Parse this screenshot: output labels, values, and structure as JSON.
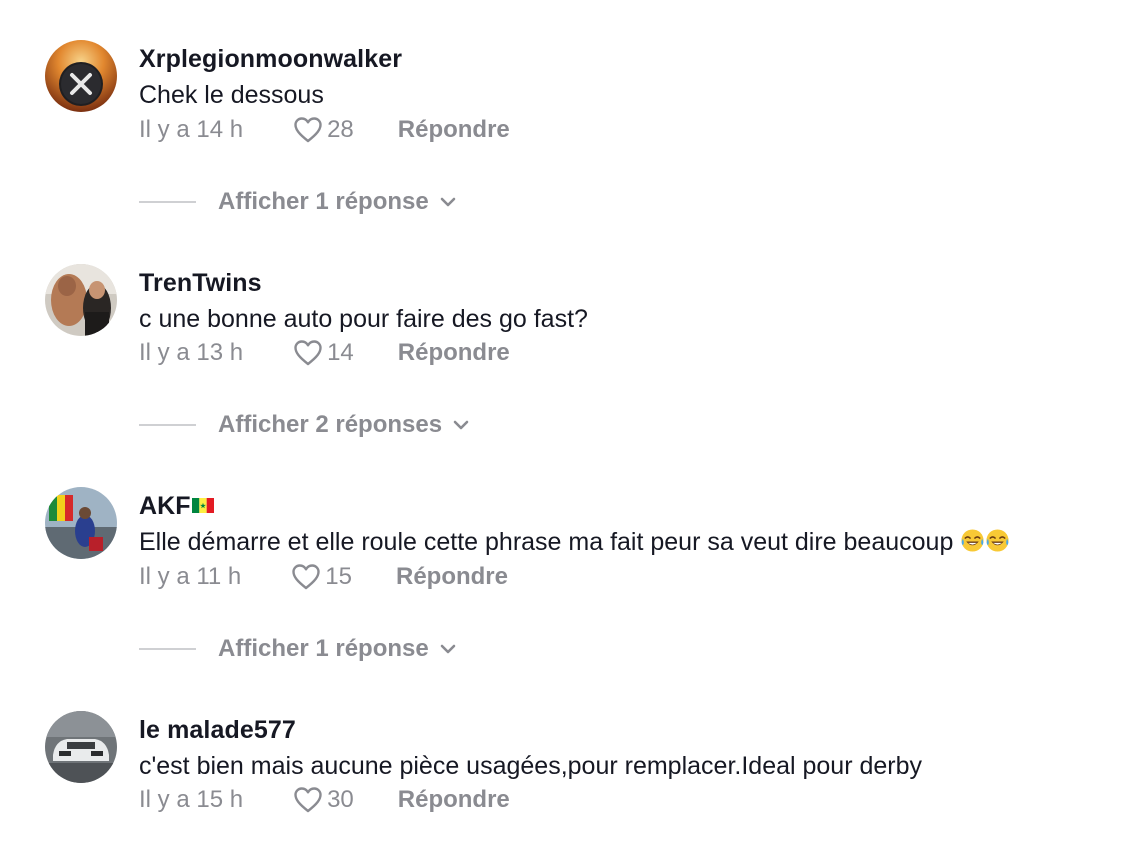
{
  "comments": [
    {
      "username": "Xrplegionmoonwalker",
      "text": "Chek le dessous",
      "time": "Il y a 14 h",
      "likes": "28",
      "reply_label": "Répondre",
      "view_replies": "Afficher 1 réponse"
    },
    {
      "username": "TrenTwins",
      "text": "c une bonne auto pour faire des go fast?",
      "time": "Il y a 13 h",
      "likes": "14",
      "reply_label": "Répondre",
      "view_replies": "Afficher 2 réponses"
    },
    {
      "username": "AKF",
      "username_flag": "senegal-flag-icon",
      "text": "Elle démarre et elle roule cette phrase ma fait peur sa veut dire beaucoup",
      "text_emojis": [
        "tears-of-joy-icon",
        "tears-of-joy-icon"
      ],
      "time": "Il y a 11 h",
      "likes": "15",
      "reply_label": "Répondre",
      "view_replies": "Afficher 1 réponse"
    },
    {
      "username": "le malade577",
      "text": "c'est bien mais aucune pièce usagées,pour remplacer.Ideal pour derby",
      "time": "Il y a 15 h",
      "likes": "30",
      "reply_label": "Répondre"
    }
  ],
  "colors": {
    "primary_text": "#161823",
    "secondary_text": "#8a8b91",
    "divider": "#cfd0d3"
  }
}
